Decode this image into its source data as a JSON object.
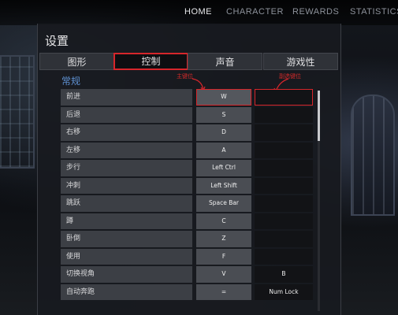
{
  "nav": {
    "items": [
      "HOME",
      "CHARACTER",
      "REWARDS",
      "STATISTICS"
    ],
    "active": "HOME"
  },
  "settings": {
    "title": "设置",
    "tabs": [
      "图形",
      "控制",
      "声音",
      "游戏性"
    ],
    "active_tab": "控制",
    "section": "常规",
    "annotations": {
      "primary": "主键位",
      "secondary": "副选键位"
    },
    "rows": [
      {
        "label": "前进",
        "primary": "W",
        "secondary": ""
      },
      {
        "label": "后退",
        "primary": "S",
        "secondary": ""
      },
      {
        "label": "右移",
        "primary": "D",
        "secondary": ""
      },
      {
        "label": "左移",
        "primary": "A",
        "secondary": ""
      },
      {
        "label": "步行",
        "primary": "Left Ctrl",
        "secondary": ""
      },
      {
        "label": "冲刺",
        "primary": "Left Shift",
        "secondary": ""
      },
      {
        "label": "跳跃",
        "primary": "Space Bar",
        "secondary": ""
      },
      {
        "label": "蹲",
        "primary": "C",
        "secondary": ""
      },
      {
        "label": "卧倒",
        "primary": "Z",
        "secondary": ""
      },
      {
        "label": "使用",
        "primary": "F",
        "secondary": ""
      },
      {
        "label": "切换视角",
        "primary": "V",
        "secondary": "B"
      },
      {
        "label": "自动奔跑",
        "primary": "=",
        "secondary": "Num Lock"
      }
    ]
  },
  "colors": {
    "highlight": "#d6262b",
    "section_title": "#5d8fd0",
    "panel_bg": "#181a1f"
  }
}
